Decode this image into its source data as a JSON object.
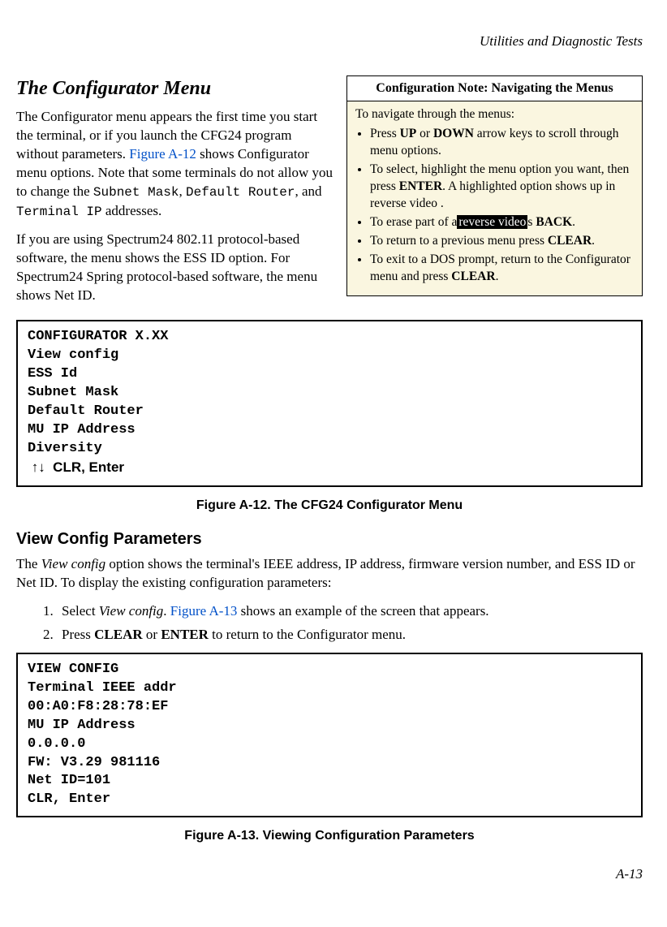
{
  "runningHead": "Utilities and Diagnostic Tests",
  "sectionTitle": "The Configurator Menu",
  "intro1a": "The Configurator menu appears the first time you start the terminal, or if you launch the CFG24 program without parameters. ",
  "figLink1": "Figure A-12",
  "intro1b": " shows Configurator menu options. Note that some terminals do not allow you to change the ",
  "monoSubnet": "Subnet Mask",
  "monoRouter": "Default Router",
  "monoTermIP": "Terminal IP",
  "intro1d": " addresses.",
  "intro2": "If you are using Spectrum24 802.11 protocol-based software, the menu shows the ESS ID option. For Spectrum24 Spring protocol-based software, the menu shows Net ID.",
  "noteTitle": "Configuration Note: Navigating the Menus",
  "noteIntro": "To navigate through the menus:",
  "noteItems": {
    "i1a": "Press ",
    "i1up": "UP",
    "i1mid": " or ",
    "i1down": "DOWN",
    "i1b": " arrow keys to scroll through menu options.",
    "i2a": "To select, highlight the menu option you want, then press ",
    "i2enter": "ENTER",
    "i2b": ". A highlighted option shows up in reverse video .",
    "i3a": "To erase part of a",
    "i3rev": "reverse video",
    "i3b": "s ",
    "i3back": "BACK",
    "i3c": ".",
    "i4a": "To return to a previous menu press ",
    "i4clear": "CLEAR",
    "i4b": ".",
    "i5a": "To exit to a DOS prompt, return to the Configurator menu and press ",
    "i5clear": "CLEAR",
    "i5b": "."
  },
  "screen1": "CONFIGURATOR X.XX\nView config\nESS Id\nSubnet Mask\nDefault Router\nMU IP Address\nDiversity",
  "screen1arrows": " ↑↓  CLR, Enter",
  "figCaption1": "Figure A-12.  The CFG24 Configurator Menu",
  "subTitle": "View Config Parameters",
  "viewPara": "The View config  option shows the terminal's IEEE address, IP address, firmware version number, and ESS ID or Net ID. To display the existing configuration parameters:",
  "viewParaItalic": "View config",
  "step1a": "Select ",
  "step1italic": "View config",
  "step1b": ". ",
  "step1link": "Figure A-13",
  "step1c": " shows an example of the screen that appears.",
  "step2a": "Press ",
  "step2clear": "CLEAR",
  "step2b": " or ",
  "step2enter": "ENTER",
  "step2c": " to return to the Configurator menu.",
  "screen2": "VIEW CONFIG\nTerminal IEEE addr\n00:A0:F8:28:78:EF\nMU IP Address\n0.0.0.0\nFW: V3.29 981116\nNet ID=101\nCLR, Enter",
  "figCaption2": "Figure A-13.  Viewing Configuration Parameters",
  "pageNum": "A-13"
}
